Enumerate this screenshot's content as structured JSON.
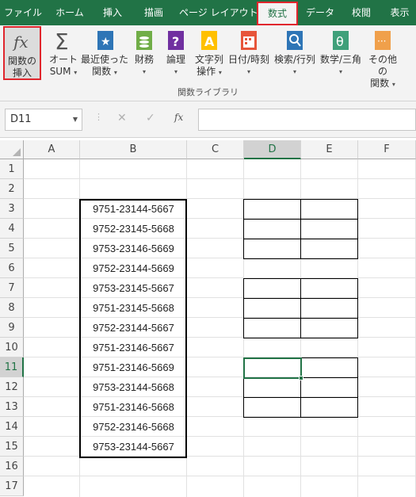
{
  "ribbon_tabs": [
    "ファイル",
    "ホーム",
    "挿入",
    "描画",
    "ページ レイアウト",
    "数式",
    "データ",
    "校閲",
    "表示"
  ],
  "active_tab": "数式",
  "ribbon_buttons": {
    "insert_function": {
      "line1": "関数の",
      "line2": "挿入"
    },
    "autosum": {
      "line1": "オート",
      "line2": "SUM"
    },
    "recent": {
      "line1": "最近使った",
      "line2": "関数"
    },
    "financial": {
      "line1": "財務"
    },
    "logical": {
      "line1": "論理"
    },
    "text": {
      "line1": "文字列",
      "line2": "操作"
    },
    "datetime": {
      "line1": "日付/時刻"
    },
    "lookup": {
      "line1": "検索/行列"
    },
    "math": {
      "line1": "数学/三角"
    },
    "more": {
      "line1": "その他の",
      "line2": "関数"
    }
  },
  "group_label": "関数ライブラリ",
  "name_box": "D11",
  "formula_bar": {
    "fx_label": "fx",
    "value": ""
  },
  "columns": [
    "A",
    "B",
    "C",
    "D",
    "E",
    "F"
  ],
  "rows": [
    "1",
    "2",
    "3",
    "4",
    "5",
    "6",
    "7",
    "8",
    "9",
    "10",
    "11",
    "12",
    "13",
    "14",
    "15",
    "16",
    "17"
  ],
  "column_b_values": [
    "9751-23144-5667",
    "9752-23145-5668",
    "9753-23146-5669",
    "9752-23144-5669",
    "9753-23145-5667",
    "9751-23145-5668",
    "9752-23144-5667",
    "9751-23146-5667",
    "9751-23146-5669",
    "9753-23144-5668",
    "9751-23146-5668",
    "9752-23146-5668",
    "9753-23144-5667"
  ],
  "colors": {
    "accent": "#217346",
    "highlight": "#e0262d"
  }
}
